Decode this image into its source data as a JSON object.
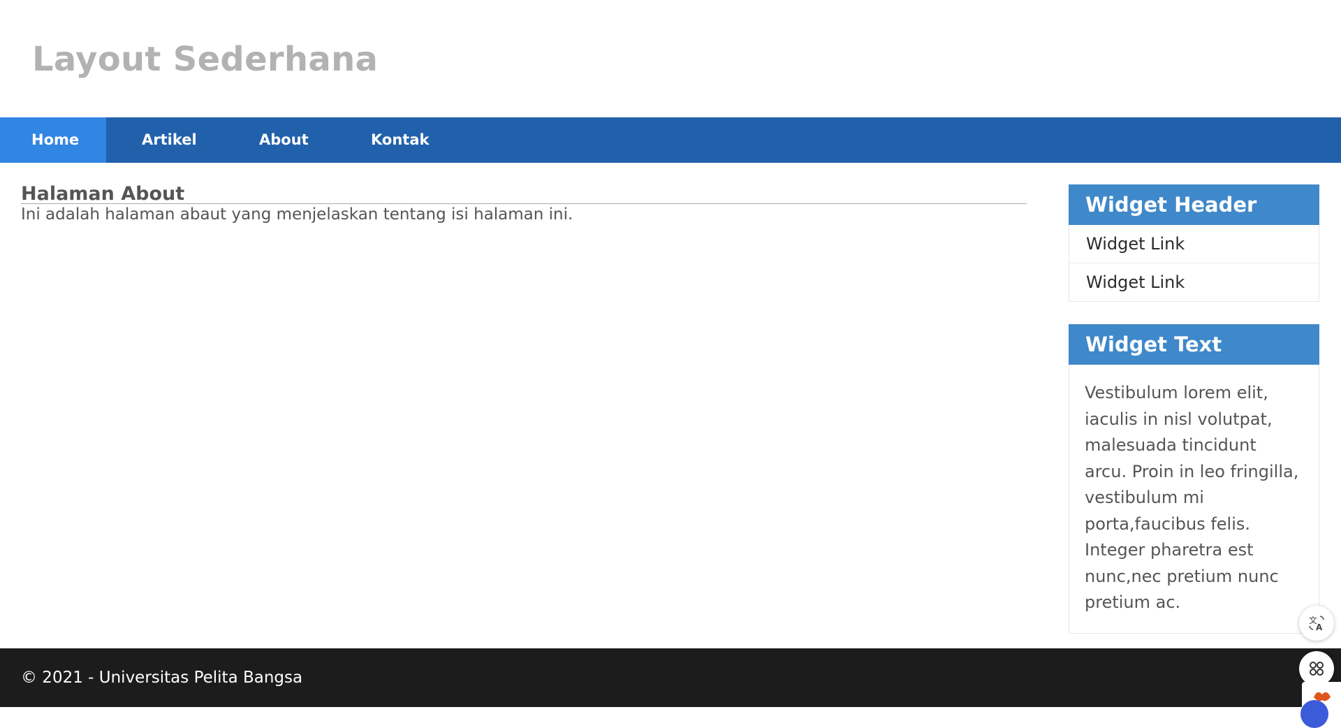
{
  "header": {
    "site_title": "Layout Sederhana"
  },
  "nav": {
    "items": [
      {
        "label": "Home",
        "active": true
      },
      {
        "label": "Artikel",
        "active": false
      },
      {
        "label": "About",
        "active": false
      },
      {
        "label": "Kontak",
        "active": false
      }
    ]
  },
  "main": {
    "heading": "Halaman About",
    "description": "Ini adalah halaman abaut yang menjelaskan tentang isi halaman ini."
  },
  "sidebar": {
    "widget_links": {
      "title": "Widget Header",
      "links": [
        "Widget Link",
        "Widget Link"
      ]
    },
    "widget_text": {
      "title": "Widget Text",
      "body": "Vestibulum lorem elit, iaculis in nisl volutpat, malesuada tincidunt arcu. Proin in leo fringilla, vestibulum mi porta,faucibus felis. Integer pharetra est nunc,nec pretium nunc pretium ac."
    }
  },
  "footer": {
    "copyright": "© 2021 - Universitas Pelita Bangsa"
  },
  "floating_tools": {
    "translate_icon": "translate-icon",
    "apps_icon": "command-icon"
  },
  "colors": {
    "nav_bg": "#2161ac",
    "nav_active_bg": "#3186e3",
    "widget_header_bg": "#3f88c9",
    "footer_bg": "#1c1c1c",
    "title_color": "#b2b2b2"
  }
}
